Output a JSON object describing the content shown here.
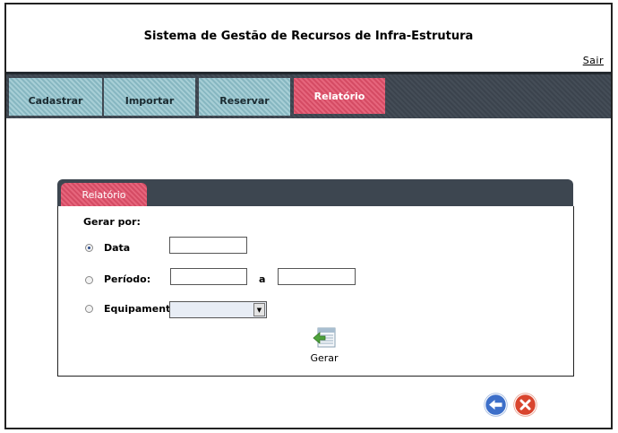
{
  "header": {
    "title": "Sistema de Gestão de Recursos de Infra-Estrutura",
    "logout_label": "Sair"
  },
  "nav": {
    "tabs": [
      {
        "label": "Cadastrar"
      },
      {
        "label": "Importar"
      },
      {
        "label": "Reservar"
      },
      {
        "label": "Relatório",
        "active": true
      }
    ]
  },
  "report": {
    "panel_title": "Relatório",
    "generate_by_label": "Gerar por:",
    "options": [
      {
        "label": "Data",
        "selected": true
      },
      {
        "label": "Período:",
        "selected": false
      },
      {
        "label": "Equipamento:",
        "selected": false
      }
    ],
    "date_value": "",
    "period_start": "",
    "period_separator": "a",
    "period_end": "",
    "equipment_selected": "",
    "generate_label": "Gerar"
  },
  "actions": {
    "back_icon": "back-arrow-icon",
    "close_icon": "close-icon"
  },
  "colors": {
    "nav_bg": "#3d4650",
    "tab_inactive": "#8ec1cb",
    "tab_active": "#e2506a",
    "back_button": "#3d6fc9",
    "close_button": "#d9452e"
  }
}
